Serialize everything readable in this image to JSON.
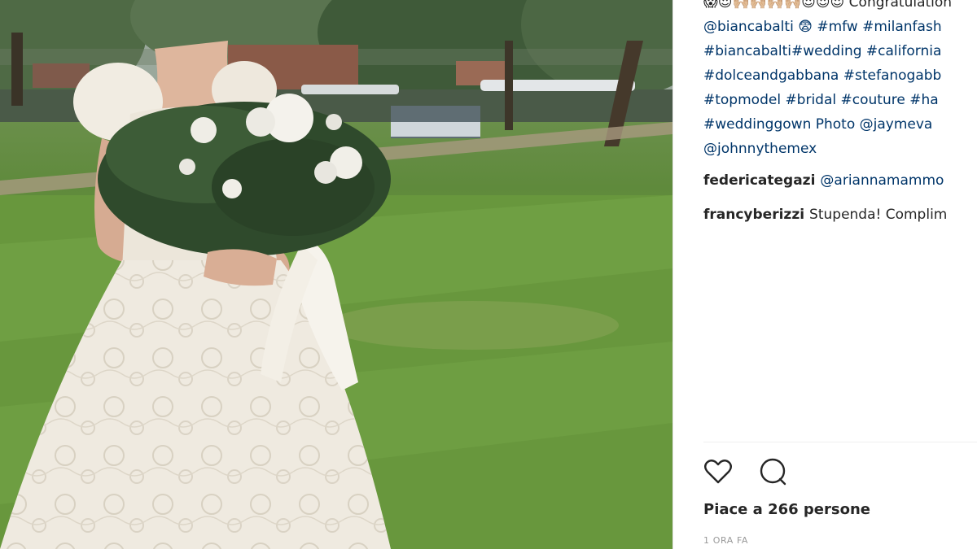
{
  "post": {
    "caption_lines": [
      "😱😍🙌🏼🙌🏼🙌🏼🙌🏼😍😍😍 Congratulation",
      "@biancabalti 😨 #mfw #milanfash",
      "#biancabalti#wedding #california",
      "#dolceandgabbana #stefanogabb",
      "#topmodel #bridal #couture #ha",
      "#weddinggown Photo @jaymeva",
      "@johnnythemex"
    ],
    "comments": [
      {
        "user": "federicategazi",
        "text": "@ariannamammo"
      },
      {
        "user": "francyberizzi",
        "text": "Stupenda! Complim"
      }
    ],
    "actions": {
      "like_icon": "heart-icon",
      "comment_icon": "comment-bubble-icon"
    },
    "likes_text": "Piace a 266 persone",
    "timestamp": "1 ORA FA"
  },
  "colors": {
    "link": "#003569",
    "text": "#262626",
    "muted": "#999999"
  }
}
